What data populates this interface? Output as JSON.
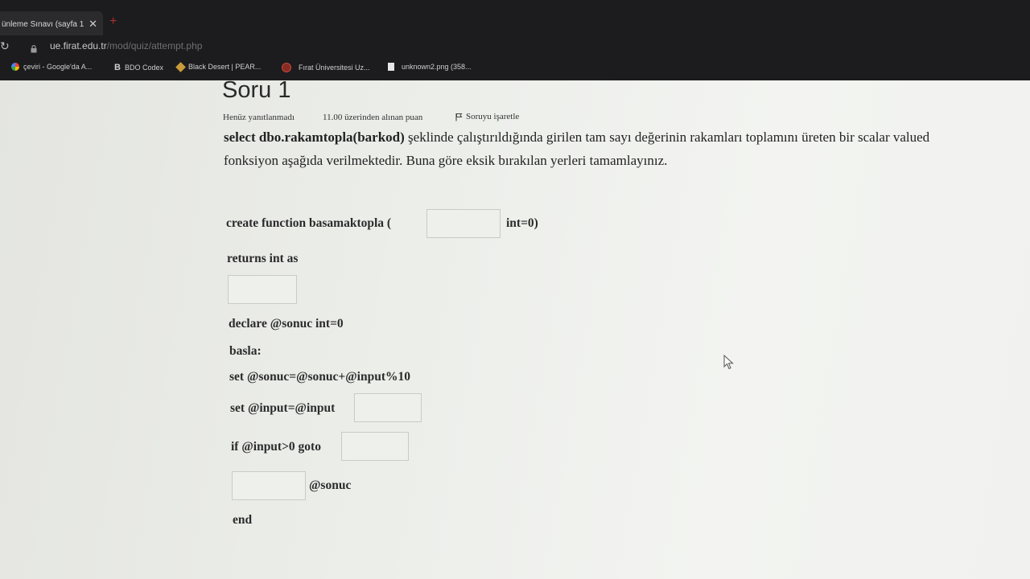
{
  "browser": {
    "tab_title": "ünleme Sınavı (sayfa 1",
    "tab_close": "✕",
    "new_tab": "+",
    "url_host": "ue.firat.edu.tr",
    "url_path": "/mod/quiz/attempt.php",
    "bookmarks": [
      {
        "label": "çeviri - Google'da A...",
        "icon": "google-icon",
        "color": "#4285f4"
      },
      {
        "label": "BDO Codex",
        "icon": "bdo-codex-icon",
        "color": "#cfcfcf"
      },
      {
        "label": "Black Desert | PEAR...",
        "icon": "black-desert-icon",
        "color": "#d0a040"
      },
      {
        "label": "Fırat Üniversitesi Uz...",
        "icon": "firat-icon",
        "color": "#b03a2e"
      },
      {
        "label": "unknown2.png (358...",
        "icon": "file-icon",
        "color": "#e0e0e0"
      }
    ]
  },
  "question": {
    "title": "Soru 1",
    "status": "Henüz yanıtlanmadı",
    "points": "11.00 üzerinden alınan puan",
    "flag_label": "Soruyu işaretle",
    "prompt_bold": "select dbo.rakamtopla(barkod)",
    "prompt_rest": " şeklinde çalıştırıldığında girilen tam sayı değerinin rakamları toplamını üreten bir scalar valued fonksiyon aşağıda verilmektedir. Buna göre eksik bırakılan yerleri tamamlayınız."
  },
  "code": {
    "line1_prefix": "create function basamaktopla (",
    "line1_suffix": "int=0)",
    "line2": "returns int as",
    "line3": "declare @sonuc int=0",
    "line4": "basla:",
    "line5": "set @sonuc=@sonuc+@input%10",
    "line6": "set @input=@input",
    "line7": "if @input>0 goto",
    "line8_suffix": "@sonuc",
    "line9": "end"
  },
  "blanks": {
    "blank1": "",
    "blank2": "",
    "blank3": "",
    "blank4": "",
    "blank5": ""
  }
}
